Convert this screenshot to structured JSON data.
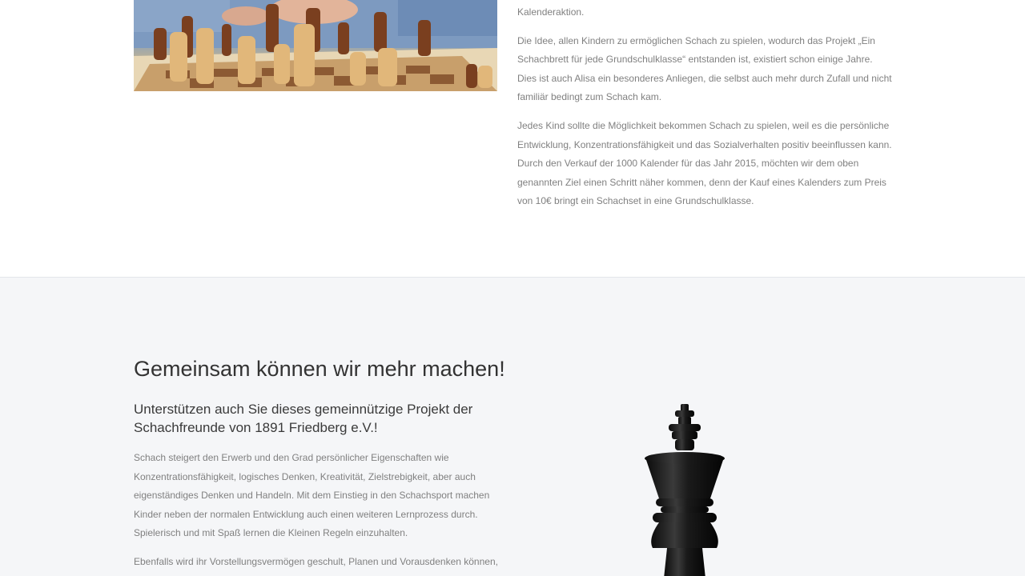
{
  "top": {
    "paragraphs": [
      "Kalenderaktion.",
      "Die Idee, allen Kindern zu ermöglichen Schach zu spielen, wodurch das Projekt „Ein Schachbrett für jede Grundschulklasse“ entstanden ist, existiert schon einige Jahre. Dies ist auch Alisa ein besonderes Anliegen, die selbst auch mehr durch Zufall und nicht familiär bedingt zum Schach kam.",
      "Jedes Kind sollte die Möglichkeit bekommen Schach zu spielen, weil es die persönliche Entwicklung, Konzentrationsfähigkeit und das Sozialverhalten positiv beeinflussen kann. Durch den Verkauf der 1000 Kalender für das Jahr 2015, möchten wir dem oben genannten Ziel einen Schritt näher kommen, denn der Kauf eines Kalenders zum Preis von 10€ bringt ein Schachset in eine Grundschulklasse."
    ]
  },
  "support": {
    "heading": "Gemeinsam können wir mehr machen!",
    "subheading": "Unterstützen auch Sie dieses gemeinnützige Projekt der Schachfreunde von 1891 Friedberg e.V.!",
    "paragraphs": [
      "Schach steigert den Erwerb und den Grad persönlicher Eigenschaften wie Konzentrationsfähigkeit, logisches Denken, Kreativität, Zielstrebigkeit, aber auch eigenständiges Denken und Handeln. Mit dem Einstieg in den Schachsport machen Kinder neben der normalen Entwicklung auch einen weiteren Lernprozess durch. Spielerisch und mit Spaß lernen die Kleinen Regeln einzuhalten.",
      "Ebenfalls wird ihr Vorstellungsvermögen geschult, Planen und Vorausdenken können,"
    ]
  },
  "colors": {
    "section_bg": "#f5f6f8",
    "heading": "#333333",
    "body_text": "#808080"
  }
}
